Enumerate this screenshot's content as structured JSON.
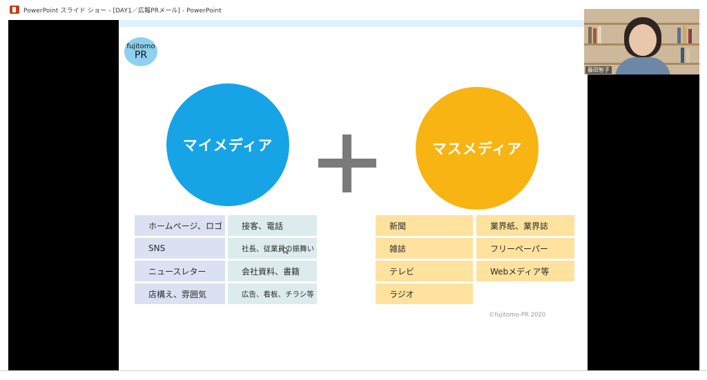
{
  "window": {
    "title": "PowerPoint スライド ショー - [DAY1／広報PRメール] - PowerPoint"
  },
  "participant": {
    "name": "藤田智子"
  },
  "slide": {
    "logo": {
      "line1": "fujitomo",
      "line2": "PR"
    },
    "left_circle": {
      "label": "マイメディア",
      "color": "#17a4e6"
    },
    "right_circle": {
      "label": "マスメディア",
      "color": "#f7b412"
    },
    "my_media_col1": [
      "ホームページ、ロゴ",
      "SNS",
      "ニュースレター",
      "店構え、雰囲気"
    ],
    "my_media_col2": [
      "接客、電話",
      "社長、従業員の振舞い",
      "会社資料、書籍",
      "広告、看板、チラシ等"
    ],
    "mass_media_col1": [
      "新聞",
      "雑誌",
      "テレビ",
      "ラジオ"
    ],
    "mass_media_col2": [
      "業界紙、業界誌",
      "フリーペーパー",
      "Webメディア等"
    ],
    "copyright": "©fujitomo-PR  2020",
    "plus_color": "#7a7a7a"
  }
}
